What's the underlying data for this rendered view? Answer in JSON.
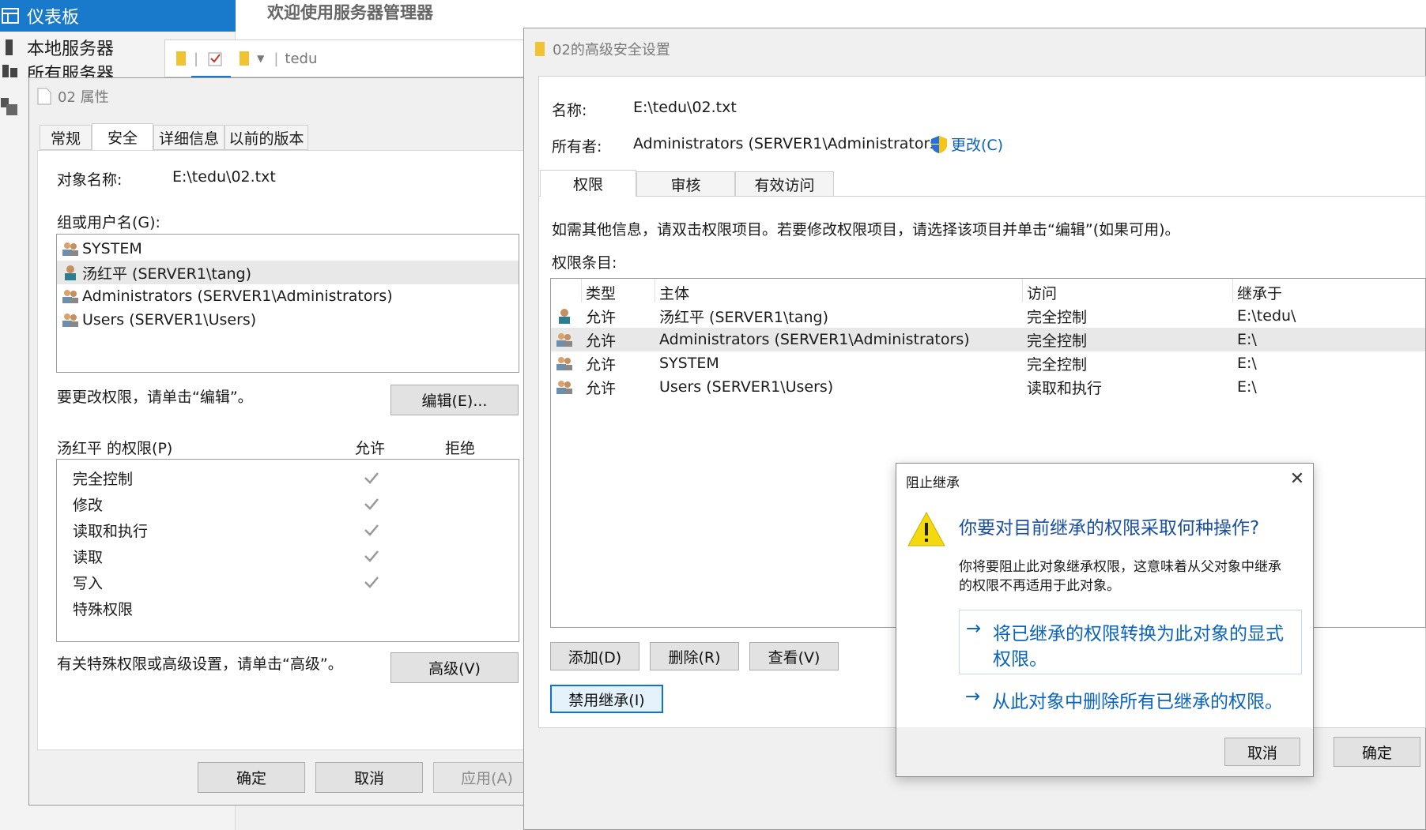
{
  "server_manager": {
    "title": "欢迎使用服务器管理器",
    "nav": [
      {
        "label": "仪表板",
        "active": true
      },
      {
        "label": "本地服务器",
        "active": false
      },
      {
        "label": "所有服务器",
        "active": false
      }
    ]
  },
  "explorer_strip": {
    "path": "tedu"
  },
  "properties": {
    "title": "02 属性",
    "tabs": [
      "常规",
      "安全",
      "详细信息",
      "以前的版本"
    ],
    "object_label": "对象名称:",
    "object_value": "E:\\tedu\\02.txt",
    "groups_label": "组或用户名(G):",
    "users": [
      "SYSTEM",
      "汤红平 (SERVER1\\tang)",
      "Administrators (SERVER1\\Administrators)",
      "Users (SERVER1\\Users)"
    ],
    "change_hint": "要更改权限，请单击“编辑”。",
    "edit_btn": "编辑(E)...",
    "perm_label": "汤红平 的权限(P)",
    "allow_col": "允许",
    "deny_col": "拒绝",
    "perms": [
      "完全控制",
      "修改",
      "读取和执行",
      "读取",
      "写入",
      "特殊权限"
    ],
    "adv_hint": "有关特殊权限或高级设置，请单击“高级”。",
    "adv_btn": "高级(V)",
    "ok": "确定",
    "cancel": "取消",
    "apply": "应用(A)"
  },
  "advanced": {
    "title": "02的高级安全设置",
    "name_label": "名称:",
    "name_value": "E:\\tedu\\02.txt",
    "owner_label": "所有者:",
    "owner_value": "Administrators (SERVER1\\Administrators)",
    "change_link": "更改(C)",
    "tabs": [
      "权限",
      "审核",
      "有效访问"
    ],
    "info": "如需其他信息，请双击权限项目。若要修改权限项目，请选择该项目并单击“编辑”(如果可用)。",
    "entries_label": "权限条目:",
    "columns": [
      "类型",
      "主体",
      "访问",
      "继承于"
    ],
    "entries": [
      {
        "type": "允许",
        "principal": "汤红平 (SERVER1\\tang)",
        "access": "完全控制",
        "from": "E:\\tedu\\"
      },
      {
        "type": "允许",
        "principal": "Administrators (SERVER1\\Administrators)",
        "access": "完全控制",
        "from": "E:\\"
      },
      {
        "type": "允许",
        "principal": "SYSTEM",
        "access": "完全控制",
        "from": "E:\\"
      },
      {
        "type": "允许",
        "principal": "Users (SERVER1\\Users)",
        "access": "读取和执行",
        "from": "E:\\"
      }
    ],
    "add_btn": "添加(D)",
    "remove_btn": "删除(R)",
    "view_btn": "查看(V)",
    "disable_inherit_btn": "禁用继承(I)",
    "ok": "确定"
  },
  "block_dialog": {
    "title": "阻止继承",
    "heading": "你要对目前继承的权限采取何种操作?",
    "body_line1": "你将要阻止此对象继承权限，这意味着从父对象中继承",
    "body_line2": "的权限不再适用于此对象。",
    "option1_line1": "将已继承的权限转换为此对象的显式",
    "option1_line2": "权限。",
    "option2": "从此对象中删除所有已继承的权限。",
    "cancel": "取消"
  },
  "colors": {
    "accent": "#1979ca",
    "link": "#0a63bd",
    "warning": "#f5d90f"
  }
}
